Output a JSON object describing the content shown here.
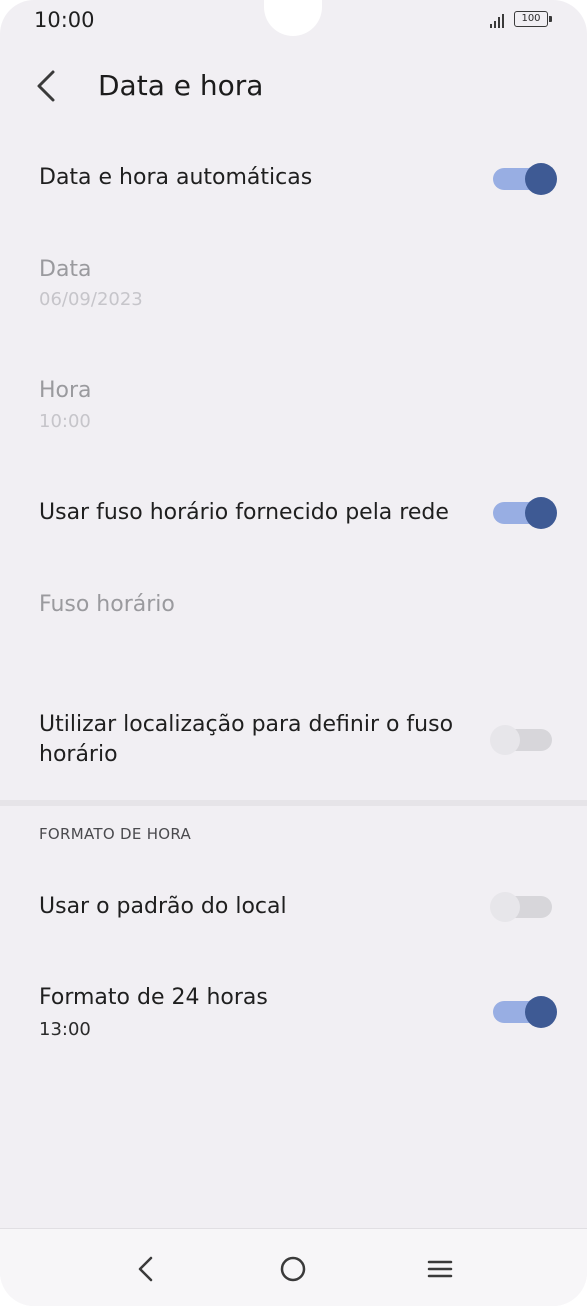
{
  "status_bar": {
    "time": "10:00",
    "battery": "100",
    "icons": [
      "signal-icon",
      "battery-icon"
    ]
  },
  "app_bar": {
    "title": "Data e hora",
    "back_icon": "back-arrow-icon"
  },
  "settings": {
    "auto_datetime": {
      "title": "Data e hora automáticas",
      "enabled": true
    },
    "date": {
      "title": "Data",
      "value": "06/09/2023"
    },
    "time": {
      "title": "Hora",
      "value": "10:00"
    },
    "network_timezone": {
      "title": "Usar fuso horário fornecido pela rede",
      "enabled": true
    },
    "timezone": {
      "title": "Fuso horário"
    },
    "location_timezone": {
      "title_line1": "Utilizar localização para definir o fuso",
      "title_line2": "horário",
      "enabled": false
    },
    "time_format_header": "FORMATO DE HORA",
    "locale_default": {
      "title": "Usar o padrão do local",
      "enabled": false
    },
    "format_24h": {
      "title": "Formato de 24 horas",
      "value": "13:00",
      "enabled": true
    }
  },
  "colors": {
    "background": "#f1eff3",
    "toggle_on_track": "#98aee3",
    "toggle_on_thumb": "#3e5a94",
    "toggle_off_track": "#d7d6da",
    "toggle_off_thumb": "#e7e6ea",
    "disabled_text": "#9a9a9e"
  },
  "nav_bar": {
    "buttons": [
      "nav-back-icon",
      "nav-home-icon",
      "nav-menu-icon"
    ]
  }
}
